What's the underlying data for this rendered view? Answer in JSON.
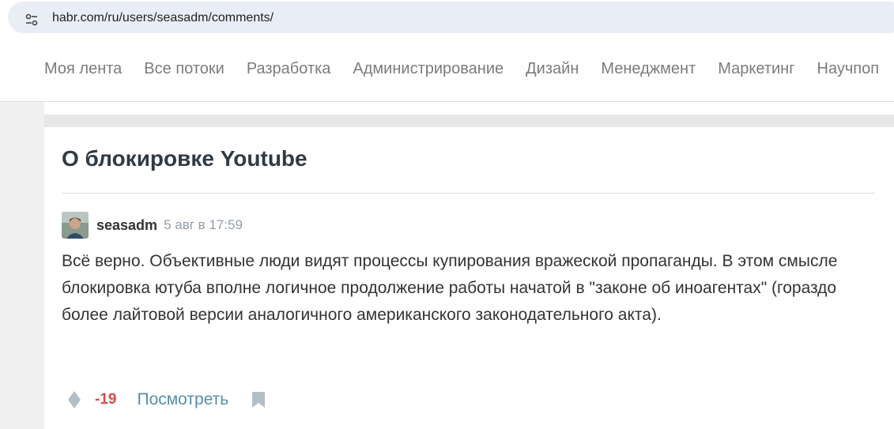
{
  "browser": {
    "url": "habr.com/ru/users/seasadm/comments/",
    "site_settings_icon": "tune-icon"
  },
  "nav": {
    "items": [
      {
        "label": "Моя лента"
      },
      {
        "label": "Все потоки"
      },
      {
        "label": "Разработка"
      },
      {
        "label": "Администрирование"
      },
      {
        "label": "Дизайн"
      },
      {
        "label": "Менеджмент"
      },
      {
        "label": "Маркетинг"
      },
      {
        "label": "Научпоп"
      }
    ]
  },
  "post": {
    "title": "О блокировке Youtube"
  },
  "comment": {
    "username": "seasadm",
    "timestamp": "5 авг в 17:59",
    "text": "Всё верно. Объективные люди видят процессы купирования вражеской пропаганды. В этом смысле блокировка ютуба вполне логичное продолжение работы начатой в \"законе об иноагентах\" (гораздо более лайтовой версии аналогичного американского законодательного акта).",
    "score": "-19",
    "view_label": "Посмотреть",
    "vote_icon": "vote-diamond-icon",
    "bookmark_icon": "bookmark-icon"
  },
  "colors": {
    "score_negative": "#d04e4e",
    "link": "#548eaa",
    "nav_text": "#7b7b7b",
    "title": "#303b44"
  }
}
